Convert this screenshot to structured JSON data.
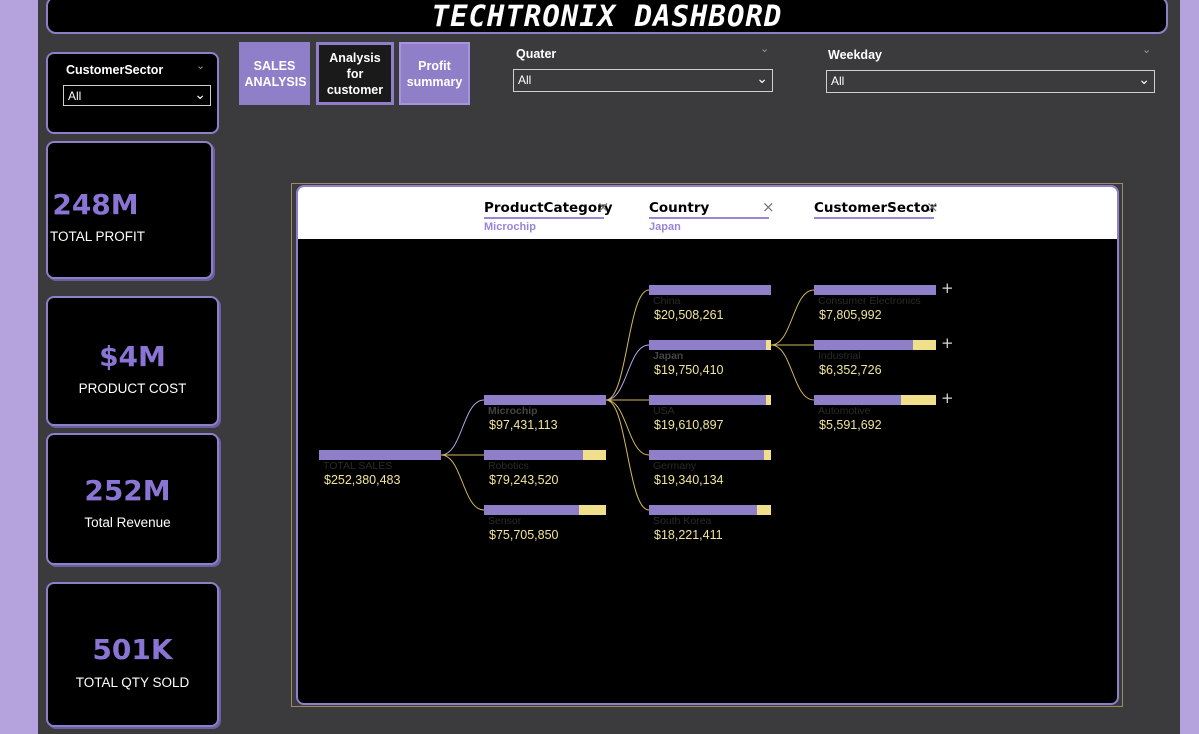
{
  "title": "TECHTRONIX DASHBORD",
  "filters": {
    "customer_sector": {
      "label": "CustomerSector",
      "value": "All"
    },
    "quater": {
      "label": "Quater",
      "value": "All"
    },
    "weekday": {
      "label": "Weekday",
      "value": "All"
    }
  },
  "nav": {
    "sales": "SALES ANALYSIS",
    "customer": "Analysis for customer",
    "profit": "Profit summary"
  },
  "kpis": [
    {
      "value": "248M",
      "label": "TOTAL PROFIT"
    },
    {
      "value": "$4M",
      "label": "PRODUCT COST"
    },
    {
      "value": "252M",
      "label": "Total Revenue"
    },
    {
      "value": "501K",
      "label": "TOTAL QTY SOLD"
    }
  ],
  "tree": {
    "levels": [
      {
        "name": "ProductCategory",
        "selected": "Microchip"
      },
      {
        "name": "Country",
        "selected": "Japan"
      },
      {
        "name": "CustomerSector",
        "selected": ""
      }
    ],
    "root": {
      "label": "TOTAL SALES",
      "value": "$252,380,483",
      "amount": 252380483
    },
    "categories": [
      {
        "label": "Microchip",
        "value": "$97,431,113",
        "amount": 97431113,
        "selected": true
      },
      {
        "label": "Robotics",
        "value": "$79,243,520",
        "amount": 79243520,
        "selected": false
      },
      {
        "label": "Sensor",
        "value": "$75,705,850",
        "amount": 75705850,
        "selected": false
      }
    ],
    "countries": [
      {
        "label": "China",
        "value": "$20,508,261",
        "amount": 20508261,
        "selected": false
      },
      {
        "label": "Japan",
        "value": "$19,750,410",
        "amount": 19750410,
        "selected": true
      },
      {
        "label": "USA",
        "value": "$19,610,897",
        "amount": 19610897,
        "selected": false
      },
      {
        "label": "Germany",
        "value": "$19,340,134",
        "amount": 19340134,
        "selected": false
      },
      {
        "label": "South Korea",
        "value": "$18,221,411",
        "amount": 18221411,
        "selected": false
      }
    ],
    "sectors": [
      {
        "label": "Consumer Electronics",
        "value": "$7,805,992",
        "amount": 7805992,
        "selected": false
      },
      {
        "label": "Industrial",
        "value": "$6,352,726",
        "amount": 6352726,
        "selected": false
      },
      {
        "label": "Automotive",
        "value": "$5,591,692",
        "amount": 5591692,
        "selected": false
      }
    ],
    "expand_symbol": "+",
    "remove_symbol": "×"
  },
  "colors": {
    "accent": "#8f7fc8",
    "bar_rest": "#f0e08c",
    "value_text": "#f2e49a",
    "link": "#d4b85c",
    "background": "#3b3b3d"
  }
}
